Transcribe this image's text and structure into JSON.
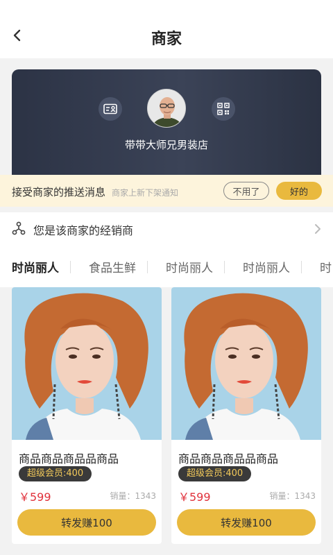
{
  "header": {
    "title": "商家"
  },
  "shop": {
    "name": "带带大师兄男装店"
  },
  "push": {
    "main": "接受商家的推送消息",
    "sub": "商家上新下架通知",
    "decline_label": "不用了",
    "accept_label": "好的"
  },
  "dealer": {
    "label": "您是该商家的经销商"
  },
  "tabs": [
    "时尚丽人",
    "食品生鲜",
    "时尚丽人",
    "时尚丽人",
    "时"
  ],
  "products": [
    {
      "title": "商品商品商品品商品",
      "badge": "超级会员:400",
      "price": "￥599",
      "sales": "销量：1343",
      "share_label": "转发赚100"
    },
    {
      "title": "商品商品商品品商品",
      "badge": "超级会员:400",
      "price": "￥599",
      "sales": "销量：1343",
      "share_label": "转发赚100"
    }
  ],
  "colors": {
    "accent": "#e9b93e",
    "price": "#e0313b",
    "card_dark": "#2c3345",
    "push_bg": "#fdf4dc"
  },
  "icons": [
    "back-icon",
    "id-card-icon",
    "qr-code-icon",
    "network-icon",
    "chevron-right-icon"
  ]
}
